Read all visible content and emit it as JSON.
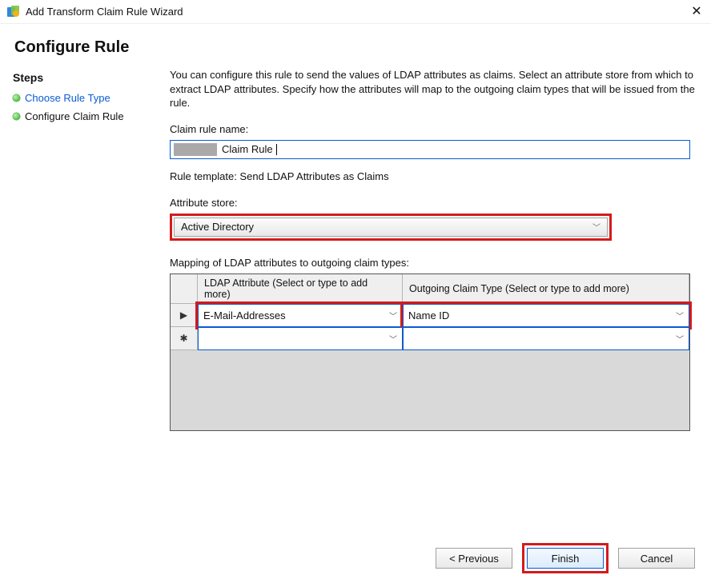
{
  "titlebar": {
    "title": "Add Transform Claim Rule Wizard",
    "close_glyph": "✕"
  },
  "page_title": "Configure Rule",
  "sidebar": {
    "title": "Steps",
    "items": [
      {
        "label": "Choose Rule Type"
      },
      {
        "label": "Configure Claim Rule"
      }
    ]
  },
  "main": {
    "instructions": "You can configure this rule to send the values of LDAP attributes as claims. Select an attribute store from which to extract LDAP attributes. Specify how the attributes will map to the outgoing claim types that will be issued from the rule.",
    "claim_rule_name_label": "Claim rule name:",
    "claim_rule_name_value_suffix": "Claim Rule",
    "rule_template_line": "Rule template: Send LDAP Attributes as Claims",
    "attribute_store_label": "Attribute store:",
    "attribute_store_value": "Active Directory",
    "mapping_label": "Mapping of LDAP attributes to outgoing claim types:",
    "grid": {
      "headers": {
        "ldap": "LDAP Attribute (Select or type to add more)",
        "claim": "Outgoing Claim Type (Select or type to add more)"
      },
      "rows": [
        {
          "marker": "▶",
          "ldap": "E-Mail-Addresses",
          "claim": "Name ID"
        },
        {
          "marker": "✱",
          "ldap": "",
          "claim": ""
        }
      ]
    }
  },
  "buttons": {
    "previous": "< Previous",
    "finish": "Finish",
    "cancel": "Cancel"
  }
}
